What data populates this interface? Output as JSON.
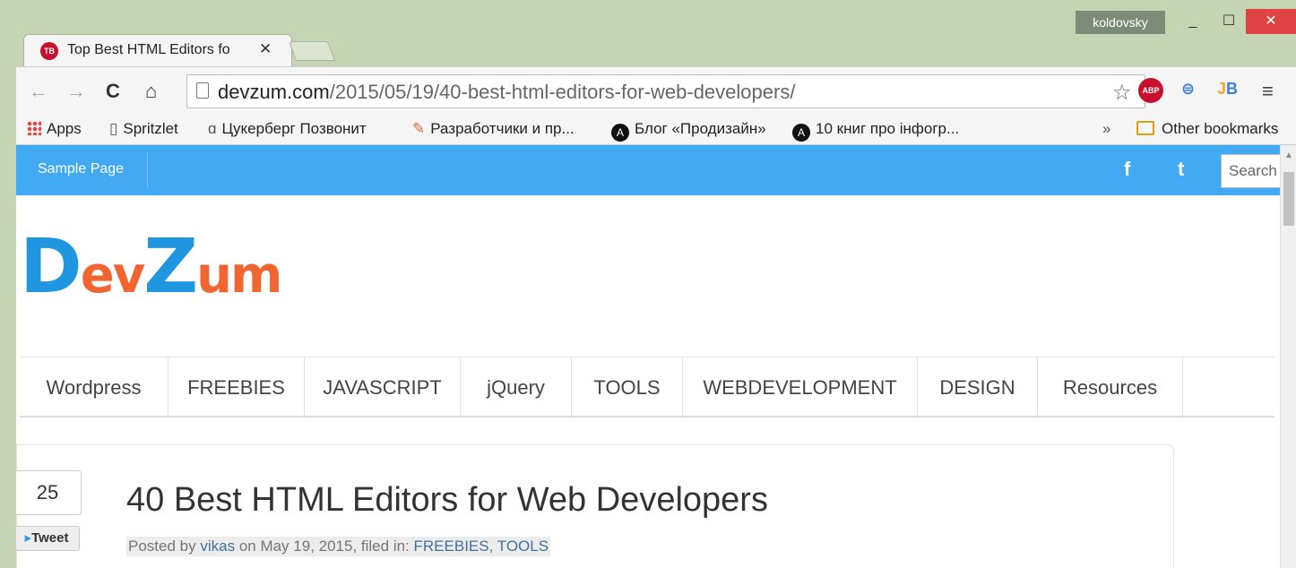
{
  "window": {
    "user": "koldovsky",
    "minimize": "_",
    "maximize": "☐",
    "close": "✕"
  },
  "tab": {
    "favicon": "TB",
    "title": "Top Best HTML Editors fo",
    "close": "✕"
  },
  "toolbar": {
    "back": "←",
    "forward": "→",
    "reload": "C",
    "home": "⌂",
    "url_host": "devzum.com",
    "url_path": "/2015/05/19/40-best-html-editors-for-web-developers/",
    "star": "☆",
    "ext_abp": "ABP",
    "ext_sync": "⊜",
    "ext_jb_j": "J",
    "ext_jb_b": "B",
    "menu": "≡"
  },
  "bookmarks": {
    "apps": "Apps",
    "items": [
      {
        "label": "Spritzlet",
        "icon": "page-icon"
      },
      {
        "label": "Цукерберг Позвонит",
        "icon": "bookmarklet-icon"
      },
      {
        "label": "Разработчики и пр...",
        "icon": "feather-icon"
      },
      {
        "label": "Блог «Продизайн»",
        "icon": "A"
      },
      {
        "label": "10 книг про інфогр...",
        "icon": "A"
      }
    ],
    "more": "»",
    "other": "Other bookmarks"
  },
  "site": {
    "topbar_link": "Sample Page",
    "facebook": "f",
    "twitter": "t",
    "search_placeholder": "Search",
    "logo_dev": "Dev",
    "logo_zum": "Zum",
    "logo_colors": {
      "blue": "#2196e0",
      "orange": "#f26531"
    },
    "accent": "#42aaf5",
    "nav": [
      "Wordpress",
      "FREEBIES",
      "JAVASCRIPT",
      "jQuery",
      "TOOLS",
      "WEBDEVELOPMENT",
      "DESIGN",
      "Resources"
    ]
  },
  "article": {
    "share_count": "25",
    "tweet_label": "Tweet",
    "title": "40 Best HTML Editors for Web Developers",
    "posted_by": "Posted by",
    "author": "vikas",
    "date_text": "on May 19, 2015, filed in:",
    "cat1": "FREEBIES",
    "cat2": "TOOLS"
  }
}
